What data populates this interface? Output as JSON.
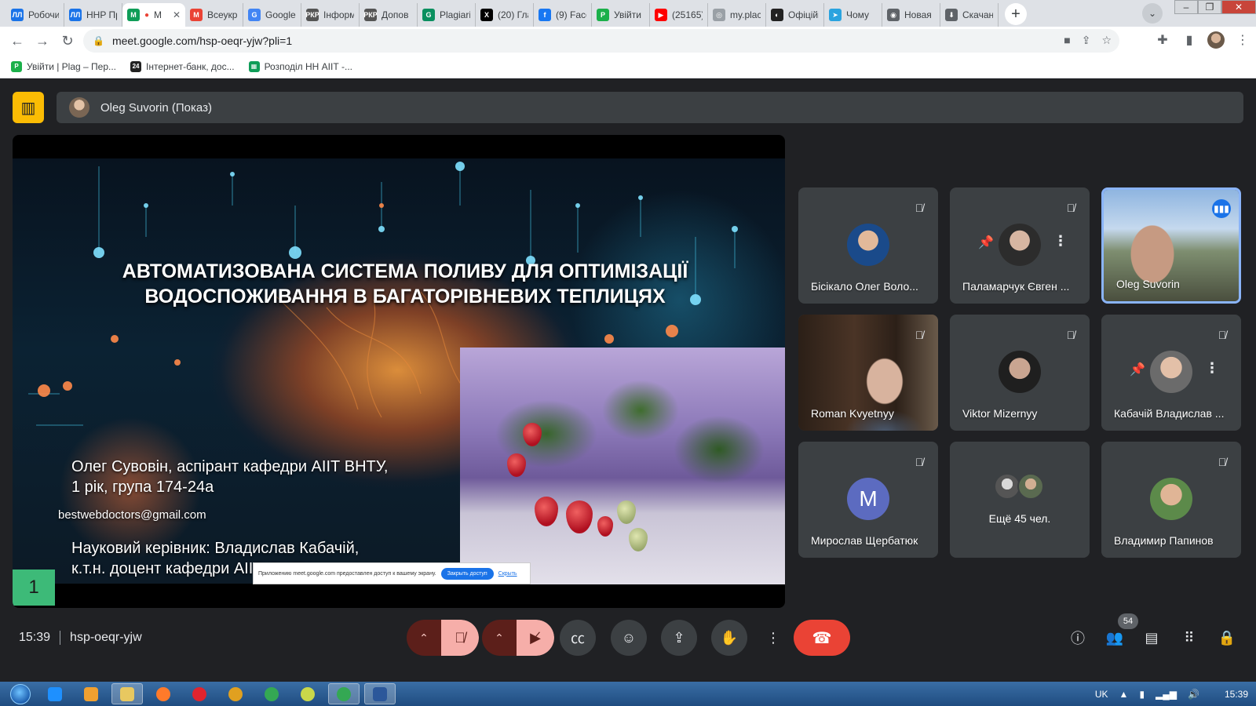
{
  "browser": {
    "tabs": [
      {
        "label": "Робочи",
        "fav_color": "#1a73e8",
        "fav_text": "ЛЛ",
        "active": false
      },
      {
        "label": "НHP Пр",
        "fav_color": "#1a73e8",
        "fav_text": "ЛЛ",
        "active": false
      },
      {
        "label": "М",
        "fav_color": "#0f9d58",
        "fav_text": "M",
        "active": true
      },
      {
        "label": "Всеукр",
        "fav_color": "#ea4335",
        "fav_text": "M",
        "active": false
      },
      {
        "label": "Google",
        "fav_color": "#4285f4",
        "fav_text": "G",
        "active": false
      },
      {
        "label": "Інформ",
        "fav_color": "#555555",
        "fav_text": "РКР",
        "active": false
      },
      {
        "label": "Допов",
        "fav_color": "#555555",
        "fav_text": "РКР",
        "active": false
      },
      {
        "label": "Plagiari",
        "fav_color": "#0a8f5f",
        "fav_text": "G",
        "active": false
      },
      {
        "label": "(20) Гла",
        "fav_color": "#000000",
        "fav_text": "X",
        "active": false
      },
      {
        "label": "(9) Face",
        "fav_color": "#1877f2",
        "fav_text": "f",
        "active": false
      },
      {
        "label": "Увійти",
        "fav_color": "#1bb04a",
        "fav_text": "P",
        "active": false
      },
      {
        "label": "(25165)",
        "fav_color": "#ff0000",
        "fav_text": "▶",
        "active": false
      },
      {
        "label": "my.plac",
        "fav_color": "#9aa0a6",
        "fav_text": "◎",
        "active": false
      },
      {
        "label": "Офіційі",
        "fav_color": "#222222",
        "fav_text": "◐",
        "active": false
      },
      {
        "label": "Чому",
        "fav_color": "#2aa3df",
        "fav_text": "➤",
        "active": false
      },
      {
        "label": "Новая",
        "fav_color": "#5f6368",
        "fav_text": "◉",
        "active": false
      },
      {
        "label": "Скачан",
        "fav_color": "#5f6368",
        "fav_text": "⬇",
        "active": false
      }
    ],
    "url": "meet.google.com/hsp-oeqr-yjw?pli=1",
    "bookmarks": [
      {
        "label": "Увійти | Plag – Пер...",
        "color": "#1bb04a",
        "glyph": "P"
      },
      {
        "label": "Інтернет-банк, дос...",
        "color": "#222222",
        "glyph": "24"
      },
      {
        "label": "Розподіл НН АІІТ -...",
        "color": "#0f9d58",
        "glyph": "▦"
      }
    ]
  },
  "meet": {
    "presenter_label": "Oleg Suvorin (Показ)",
    "slide": {
      "title_line1": "АВТОМАТИЗОВАНА СИСТЕМА ПОЛИВУ ДЛЯ ОПТИМІЗАЦІЇ",
      "title_line2": "ВОДОСПОЖИВАННЯ В БАГАТОРІВНЕВИХ ТЕПЛИЦЯХ",
      "author_line1": "Олег Сувовін, аспірант кафедри АІІТ ВНТУ,",
      "author_line2": "1 рік, група 174-24а",
      "email": "bestwebdoctors@gmail.com",
      "supervisor_line1": "Науковий керівник: Владислав Кабачій,",
      "supervisor_line2": "к.т.н. доцент кафедри АІІТ, ВНТУ",
      "number": "1",
      "share_notice_text": "Приложению meet.google.com предоставлен доступ к вашему экрану.",
      "share_stop_label": "Закрыть доступ",
      "share_hide_label": "Скрыть"
    },
    "participants": [
      {
        "name": "Бісікало Олег Воло...",
        "muted": true,
        "kind": "avatar"
      },
      {
        "name": "Паламарчук Євген ...",
        "muted": true,
        "kind": "avatar-pinnable"
      },
      {
        "name": "Oleg Suvorin",
        "muted": false,
        "kind": "video-speaking"
      },
      {
        "name": "Roman Kvyetnyy",
        "muted": true,
        "kind": "video"
      },
      {
        "name": "Viktor Mizernyy",
        "muted": true,
        "kind": "avatar"
      },
      {
        "name": "Кабачій Владислав ...",
        "muted": true,
        "kind": "avatar-pinnable"
      },
      {
        "name": "Мирослав Щербатюк",
        "muted": true,
        "kind": "letter",
        "letter": "M"
      },
      {
        "name": "Ещё 45 чел.",
        "muted": false,
        "kind": "more"
      },
      {
        "name": "Владимир Папинов",
        "muted": true,
        "kind": "avatar"
      }
    ],
    "time": "15:39",
    "meeting_code": "hsp-oeqr-yjw",
    "participants_count": "54"
  },
  "taskbar": {
    "lang": "UK",
    "clock": "15:39"
  },
  "colors": {
    "meet_bg": "#202124",
    "tile_bg": "#3c4043",
    "hangup": "#ea4335",
    "present_accent": "#fbbc04",
    "speaking_border": "#8ab4f8"
  }
}
